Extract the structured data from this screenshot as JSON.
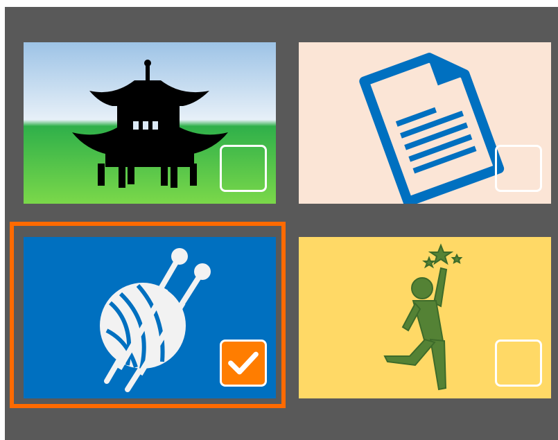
{
  "grid": {
    "tiles": [
      {
        "subject": "pagoda-icon",
        "background": "sky-over-grass",
        "selected": false
      },
      {
        "subject": "document-icon",
        "background": "#fbe5d6",
        "selected": false
      },
      {
        "subject": "yarn-and-needles-icon",
        "background": "#0070c0",
        "selected": true
      },
      {
        "subject": "person-reaching-for-stars-icon",
        "background": "#ffd966",
        "selected": false
      }
    ]
  },
  "colors": {
    "panel": "#595959",
    "selection_border": "#ff6a00",
    "checkbox_checked": "#ff7d00",
    "checkbox_border": "#ffffff",
    "document_blue": "#0070c0",
    "figure_green": "#548235"
  }
}
